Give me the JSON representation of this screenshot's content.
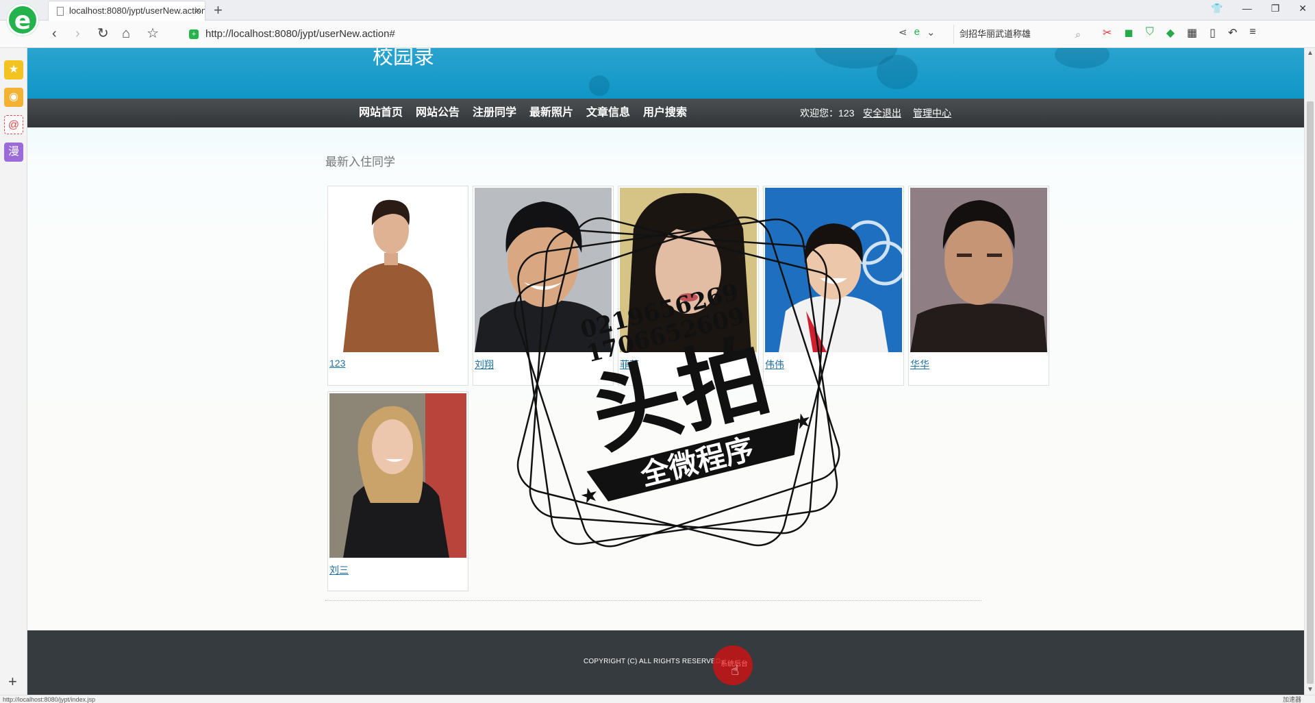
{
  "browser": {
    "tab_title": "localhost:8080/jypt/userNew.action",
    "tab_close": "×",
    "new_tab": "+",
    "url": "http://localhost:8080/jypt/userNew.action#",
    "search_text": "剑招华丽武道称雄",
    "status_url": "http://localhost:8080/jypt/index.jsp",
    "status_right": "加速器"
  },
  "site": {
    "banner_title": "校园录",
    "nav": [
      {
        "label": "网站首页"
      },
      {
        "label": "网站公告"
      },
      {
        "label": "注册同学"
      },
      {
        "label": "最新照片"
      },
      {
        "label": "文章信息"
      },
      {
        "label": "用户搜索"
      }
    ],
    "welcome": "欢迎您：123",
    "logout": "安全退出",
    "admin": "管理中心"
  },
  "section": {
    "title": "最新入住同学",
    "users": [
      {
        "name": "123"
      },
      {
        "name": "刘翔"
      },
      {
        "name": "菲菲"
      },
      {
        "name": "伟伟"
      },
      {
        "name": "华华"
      },
      {
        "name": "刘三"
      }
    ]
  },
  "footer": {
    "copyright": "COPYRIGHT (C) ALL RIGHTS RESERVED.",
    "backend": "系统后台"
  },
  "watermark": {
    "line1": "0219656269",
    "line2": "1706652609",
    "big": "头拍",
    "ribbon": "全微程序"
  },
  "colors": {
    "banner": "#1a9fcc",
    "navbar": "#3d4144",
    "footer": "#353b3e",
    "link": "#1a6fa3"
  }
}
